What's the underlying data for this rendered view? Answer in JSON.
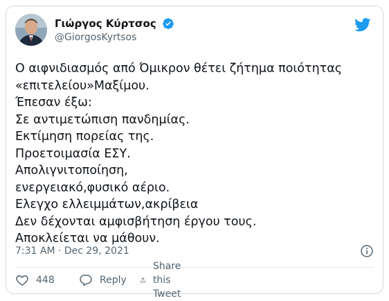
{
  "author": {
    "display_name": "Γιώργος Κύρτσος",
    "handle": "@GiorgosKyrtsos",
    "verified": true
  },
  "tweet": {
    "text": "Ο αιφνιδιασμός από Όμικρον θέτει ζήτημα ποιότητας\n«επιτελείου»Μαξίμου.\nΈπεσαν έξω:\nΣε αντιμετώπιση πανδημίας.\nΕκτίμηση πορείας της.\nΠροετοιμασία ΕΣΥ.\nΑπολιγνιτοποίηση,\nενεργειακό,φυσικό αέριο.\nΕλεγχο ελλειμμάτων,ακρίβεια\nΔεν δέχονται αμφισβήτηση έργου τους.\nΑποκλείεται να μάθουν.",
    "timestamp": "7:31 AM · Dec 29, 2021"
  },
  "actions": {
    "like_count": "448",
    "reply_label": "Reply",
    "share_label": "Share this Tweet"
  },
  "icons": {
    "twitter_logo": "twitter-bird-icon",
    "verified": "verified-badge-icon",
    "info": "info-icon",
    "like": "heart-icon",
    "reply": "reply-bubble-icon",
    "share": "share-icon"
  },
  "colors": {
    "brand_blue": "#1d9bf0",
    "text_primary": "#0f1419",
    "text_secondary": "#536471",
    "border": "#cfd9de"
  }
}
